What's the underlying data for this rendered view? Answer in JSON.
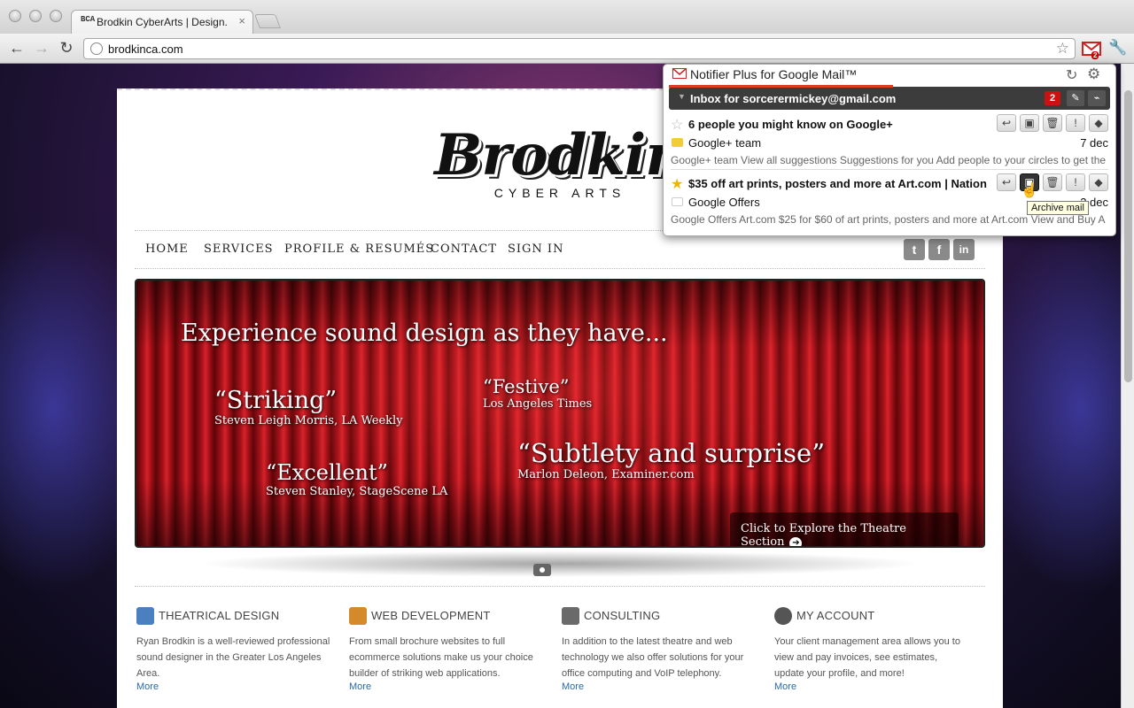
{
  "browser": {
    "tab_title": "Brodkin CyberArts | Design.",
    "tab_favicon": "BCA",
    "tab_close": "×",
    "url": "brodkinca.com",
    "nav": {
      "back_icon": "arrow-left",
      "forward_icon": "arrow-right",
      "reload_icon": "reload",
      "bookmark_icon": "star"
    },
    "extension_badge": "2"
  },
  "site": {
    "logo": {
      "name": "Brodkin",
      "tagline": "CYBER ARTS"
    },
    "nav_items": [
      "HOME",
      "SERVICES",
      "PROFILE & RESUMÉS",
      "CONTACT",
      "SIGN IN"
    ],
    "social": [
      "t",
      "f",
      "in"
    ],
    "hero": {
      "title": "Experience sound design as they have...",
      "quotes": [
        {
          "quote": "“Striking”",
          "source": "Steven Leigh Morris, LA Weekly"
        },
        {
          "quote": "“Festive”",
          "source": "Los Angeles Times"
        },
        {
          "quote": "“Excellent”",
          "source": "Steven Stanley, StageScene LA"
        },
        {
          "quote": "“Subtlety and surprise”",
          "source": "Marlon Deleon, Examiner.com"
        }
      ],
      "cta": "Click to Explore the Theatre Section"
    },
    "features": [
      {
        "title": "THEATRICAL DESIGN",
        "text": "Ryan Brodkin is a well-reviewed professional sound designer in the Greater Los Angeles Area.",
        "more": "More",
        "icon": "speaker-icon",
        "color": "#4a7fc0"
      },
      {
        "title": "WEB DEVELOPMENT",
        "text": "From small brochure websites to full ecommerce solutions make us your choice builder of striking web applications.",
        "more": "More",
        "icon": "tools-icon",
        "color": "#d48a2a"
      },
      {
        "title": "CONSULTING",
        "text": "In addition to the latest theatre and web technology we also offer solutions for your office computing and VoIP telephony.",
        "more": "More",
        "icon": "phone-icon",
        "color": "#6a6a6a"
      },
      {
        "title": "MY ACCOUNT",
        "text": "Your client management area allows you to view and pay invoices, see estimates, update your profile, and more!",
        "more": "More",
        "icon": "user-icon",
        "color": "#555555"
      }
    ]
  },
  "notifier": {
    "title": "Notifier Plus for Google Mail™",
    "inbox_label": "Inbox for sorcerermickey@gmail.com",
    "unread_count": "2",
    "messages": [
      {
        "subject": "6 people you might know on Google+",
        "from": "Google+ team",
        "date": "7 dec",
        "snippet": "Google+ team View all suggestions Suggestions for you Add people to your circles to get the",
        "starred": false,
        "label_color": "#f3cc3a"
      },
      {
        "subject": "$35 off art prints, posters and more at Art.com | Nation",
        "from": "Google Offers",
        "date": "2 dec",
        "snippet": "Google Offers Art.com $25 for $60 of art prints, posters and more at Art.com View and Buy A",
        "starred": true,
        "label_color": "#ffffff"
      }
    ],
    "tooltip": "Archive mail"
  },
  "colors": {
    "accent_red": "#c11111",
    "star_gold": "#f0b400",
    "link": "#2a6ab0"
  }
}
